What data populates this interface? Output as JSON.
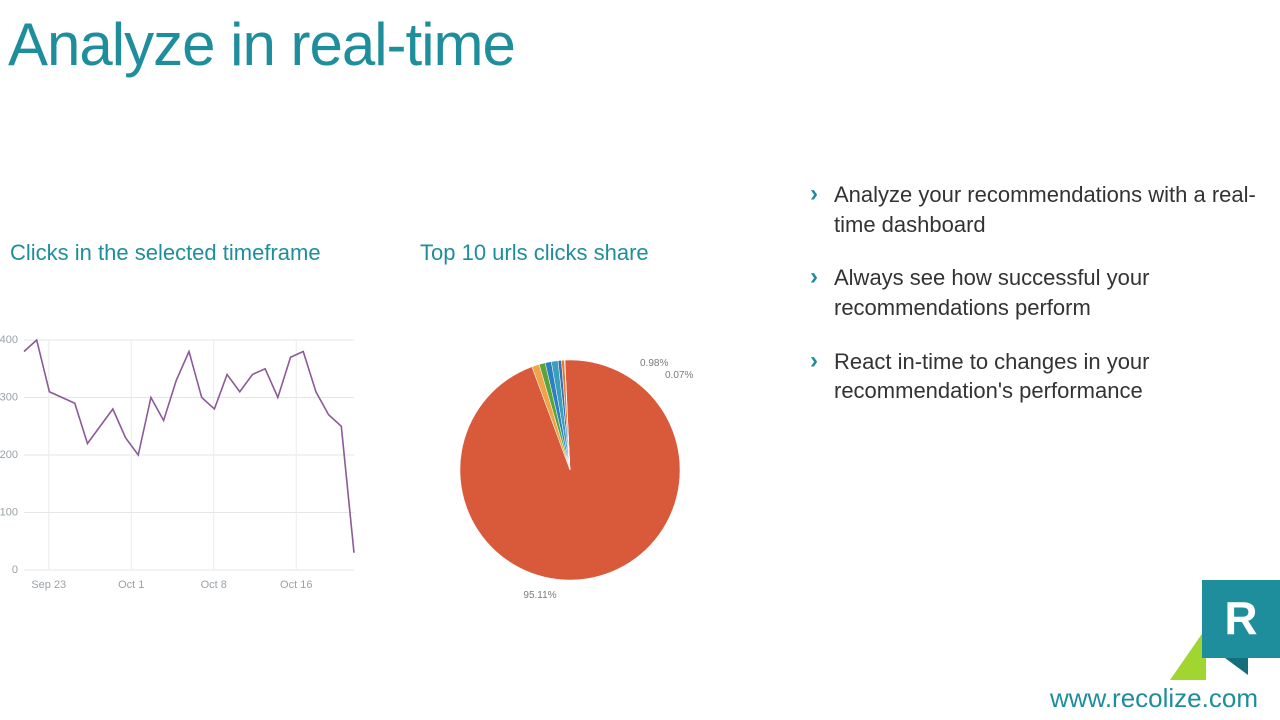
{
  "title": "Analyze in real-time",
  "bullets": [
    "Analyze your recommendations with a real-time dashboard",
    "Always see how successful your recommendations perform",
    "React in-time to changes in your recommendation's performance"
  ],
  "footer_url": "www.recolize.com",
  "logo_letter": "R",
  "chart_data": [
    {
      "type": "line",
      "title": "Clicks in the selected timeframe",
      "xlabel": "",
      "ylabel": "",
      "ylim": [
        0,
        400
      ],
      "y_ticks": [
        0,
        100,
        200,
        300,
        400
      ],
      "x_tick_labels": [
        "Sep 23",
        "Oct 1",
        "Oct 8",
        "Oct 16"
      ],
      "values": [
        380,
        400,
        310,
        300,
        290,
        220,
        250,
        280,
        230,
        200,
        300,
        260,
        330,
        380,
        300,
        280,
        340,
        310,
        340,
        350,
        300,
        370,
        380,
        310,
        270,
        250,
        30
      ],
      "line_color": "#8b5a99"
    },
    {
      "type": "pie",
      "title": "Top 10 urls clicks share",
      "slices": [
        {
          "label": "95.11%",
          "value": 95.11,
          "color": "#d9593b"
        },
        {
          "label": "",
          "value": 1.1,
          "color": "#f0a44a"
        },
        {
          "label": "",
          "value": 0.9,
          "color": "#5aa43c"
        },
        {
          "label": "",
          "value": 0.9,
          "color": "#2e7fc1"
        },
        {
          "label": "0.98%",
          "value": 0.98,
          "color": "#38a0b8"
        },
        {
          "label": "",
          "value": 0.5,
          "color": "#3f6fab"
        },
        {
          "label": "",
          "value": 0.44,
          "color": "#e57b3b"
        },
        {
          "label": "0.07%",
          "value": 0.07,
          "color": "#8fbf5a"
        }
      ]
    }
  ],
  "colors": {
    "brand_teal": "#1f8e9c",
    "brand_green": "#a0d62f"
  }
}
